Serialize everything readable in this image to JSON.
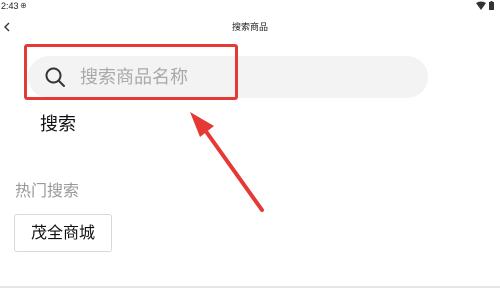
{
  "status_bar": {
    "time": "2:43",
    "extra": "⊕"
  },
  "header": {
    "title": "搜索商品",
    "back_icon": "chevron-left-icon"
  },
  "search": {
    "placeholder": "搜索商品名称",
    "value": "",
    "button_label": "搜索",
    "icon": "search-icon"
  },
  "hot": {
    "title": "热门搜索",
    "tags": [
      "茂全商城"
    ]
  },
  "colors": {
    "highlight": "#e53935",
    "search_bg": "#f3f3f3",
    "muted_text": "#999999"
  }
}
